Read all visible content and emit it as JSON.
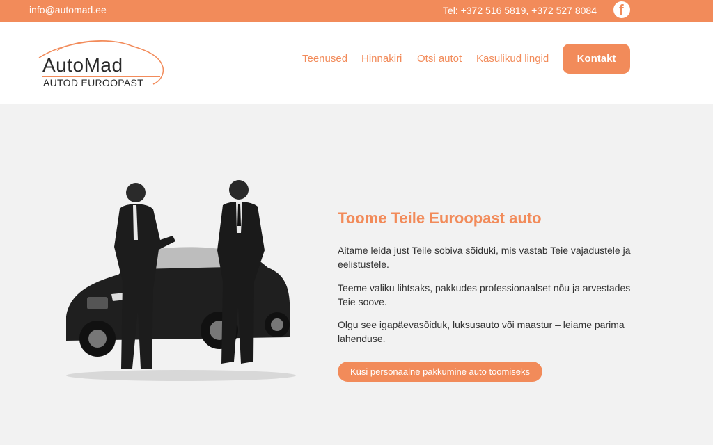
{
  "topbar": {
    "email": "info@automad.ee",
    "phone": "Tel: +372 516 5819, +372 527 8084",
    "facebook_icon": "facebook-icon"
  },
  "logo": {
    "name": "AutoMad",
    "tagline": "AUTOD EUROOPAST"
  },
  "nav": {
    "items": [
      "Teenused",
      "Hinnakiri",
      "Otsi autot",
      "Kasulikud lingid"
    ],
    "contact_button": "Kontakt"
  },
  "hero": {
    "title": "Toome Teile Euroopast auto",
    "paragraphs": [
      "Aitame leida just Teile sobiva sõiduki, mis vastab Teie vajadustele ja eelistustele.",
      "Teeme valiku lihtsaks, pakkudes professionaalset nõu ja arvestades Teie soove.",
      "Olgu see igapäevasõiduk, luksusauto või maastur – leiame parima lahenduse."
    ],
    "cta": "Küsi personaalne pakkumine auto toomiseks"
  },
  "colors": {
    "accent": "#f28b5a",
    "background": "#f2f2f2",
    "text": "#333333"
  }
}
